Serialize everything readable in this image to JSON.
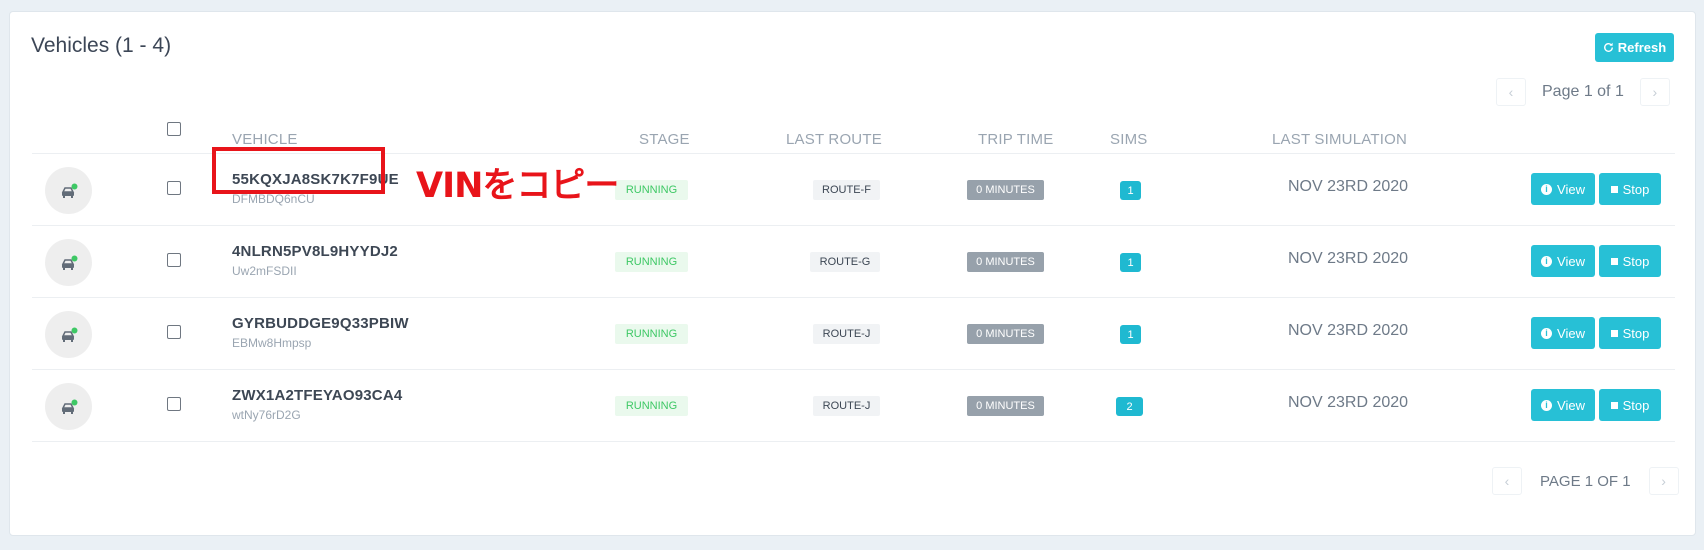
{
  "header": {
    "title": "Vehicles (1 - 4)",
    "refresh_label": "Refresh",
    "pager_top": "Page 1 of 1",
    "pager_bottom": "PAGE 1 OF 1"
  },
  "columns": {
    "vehicle": "VEHICLE",
    "stage": "STAGE",
    "last_route": "LAST ROUTE",
    "trip_time": "TRIP TIME",
    "sims": "SIMS",
    "last_simulation": "LAST SIMULATION"
  },
  "rows": [
    {
      "vin": "55KQXJA8SK7K7F9UE",
      "sub_id": "DFMBDQ6nCU",
      "stage": "RUNNING",
      "route": "ROUTE-F",
      "trip_time": "0 MINUTES",
      "sims": "1",
      "last_simulation": "NOV 23RD 2020",
      "view_label": "View",
      "stop_label": "Stop"
    },
    {
      "vin": "4NLRN5PV8L9HYYDJ2",
      "sub_id": "Uw2mFSDII",
      "stage": "RUNNING",
      "route": "ROUTE-G",
      "trip_time": "0 MINUTES",
      "sims": "1",
      "last_simulation": "NOV 23RD 2020",
      "view_label": "View",
      "stop_label": "Stop"
    },
    {
      "vin": "GYRBUDDGE9Q33PBIW",
      "sub_id": "EBMw8Hmpsp",
      "stage": "RUNNING",
      "route": "ROUTE-J",
      "trip_time": "0 MINUTES",
      "sims": "1",
      "last_simulation": "NOV 23RD 2020",
      "view_label": "View",
      "stop_label": "Stop"
    },
    {
      "vin": "ZWX1A2TFEYAO93CA4",
      "sub_id": "wtNy76rD2G",
      "stage": "RUNNING",
      "route": "ROUTE-J",
      "trip_time": "0 MINUTES",
      "sims": "2",
      "last_simulation": "NOV 23RD 2020",
      "view_label": "View",
      "stop_label": "Stop"
    }
  ],
  "annotation": {
    "text": "VINをコピー",
    "color": "#e8141a"
  },
  "icons": {
    "refresh": "refresh-icon",
    "avatar": "car-icon",
    "status": "online-dot-icon",
    "view": "info-icon",
    "stop": "stop-icon",
    "prev": "chevron-left-icon",
    "next": "chevron-right-icon"
  },
  "colors": {
    "accent": "#27c0d6",
    "running_bg": "#eaf9ed",
    "running_text": "#3ec865",
    "trip_badge": "#97a1ab",
    "online": "#3ec865"
  }
}
